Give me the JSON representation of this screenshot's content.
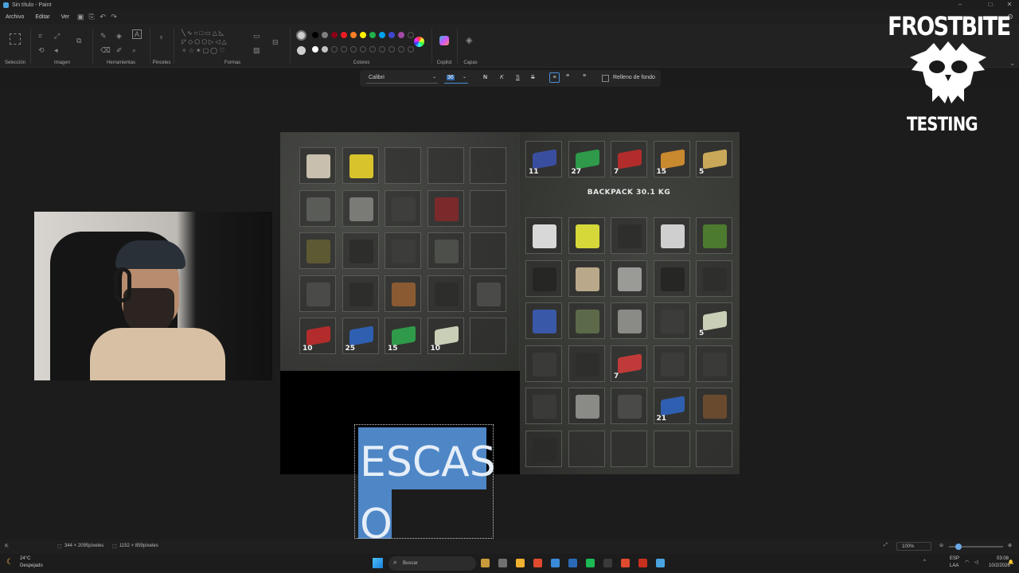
{
  "titlebar": {
    "title": "Sin título - Paint"
  },
  "menu": {
    "file": "Archivo",
    "edit": "Editar",
    "view": "Ver"
  },
  "ribbon": {
    "groups": [
      "Selección",
      "Imagen",
      "Herramientas",
      "Pinceles",
      "Formas",
      "Colores",
      "Copilot",
      "Capas"
    ]
  },
  "textbar": {
    "font": "Calibri",
    "size": "36",
    "bold": "N",
    "italic": "K",
    "underline": "S",
    "strike": "S",
    "fill_label": "Relleno de fondo"
  },
  "colors": {
    "palette_row1": [
      "#000000",
      "#7f7f7f",
      "#880015",
      "#ed1c24",
      "#ff7f27",
      "#fff200",
      "#22b14c",
      "#00a2e8",
      "#3f48cc",
      "#a349a4"
    ],
    "palette_row2": [
      "#ffffff",
      "#c3c3c3"
    ],
    "primary": "#d0d0d0",
    "secondary": "#d0d0d0"
  },
  "inventory": {
    "backpack_label": "BACKPACK 30.1 KG",
    "top_slots": [
      {
        "qty": "11",
        "color": "#3a4ea0",
        "icon": "ammo-box-icon"
      },
      {
        "qty": "27",
        "color": "#2e9a4a",
        "icon": "ammo-box-icon"
      },
      {
        "qty": "7",
        "color": "#b22c2c",
        "icon": "ammo-box-icon"
      },
      {
        "qty": "15",
        "color": "#c9892e",
        "icon": "ammo-box-icon"
      },
      {
        "qty": "5",
        "color": "#c9a85a",
        "icon": "ammo-box-icon"
      }
    ],
    "left_grid": [
      [
        {
          "qty": "",
          "color": "#c8bfae",
          "icon": "bag-icon"
        },
        {
          "qty": "",
          "color": "#d8c32c",
          "icon": "canned-food-icon"
        },
        {
          "qty": "",
          "color": "",
          "icon": ""
        },
        {
          "qty": "",
          "color": "",
          "icon": ""
        },
        {
          "qty": "",
          "color": "",
          "icon": ""
        }
      ],
      [
        {
          "qty": "",
          "color": "#5a5c58",
          "icon": "tool-icon"
        },
        {
          "qty": "",
          "color": "#7a7a76",
          "icon": "knife-icon"
        },
        {
          "qty": "",
          "color": "#3e3f3c",
          "icon": "rifle-part-icon"
        },
        {
          "qty": "",
          "color": "#7a2a2a",
          "icon": "flashlight-icon"
        },
        {
          "qty": "",
          "color": "",
          "icon": ""
        }
      ],
      [
        {
          "qty": "",
          "color": "#5d5a33",
          "icon": "camo-jacket-icon"
        },
        {
          "qty": "",
          "color": "#2d2e2c",
          "icon": "cap-icon"
        },
        {
          "qty": "",
          "color": "#3c3d3a",
          "icon": "helmet-icon"
        },
        {
          "qty": "",
          "color": "#4d4f4a",
          "icon": "vest-icon"
        },
        {
          "qty": "",
          "color": "",
          "icon": ""
        }
      ],
      [
        {
          "qty": "",
          "color": "#4a4b48",
          "icon": "revolver-icon"
        },
        {
          "qty": "",
          "color": "#2d2e2c",
          "icon": "assault-rifle-icon"
        },
        {
          "qty": "",
          "color": "#8a5a32",
          "icon": "ak-rifle-icon"
        },
        {
          "qty": "",
          "color": "#2d2e2c",
          "icon": "rifle-icon"
        },
        {
          "qty": "",
          "color": "#4a4b48",
          "icon": "smg-icon"
        }
      ],
      [
        {
          "qty": "10",
          "color": "#b22c2c",
          "icon": "ammo-box-icon"
        },
        {
          "qty": "25",
          "color": "#2f5fb0",
          "icon": "ammo-box-icon"
        },
        {
          "qty": "15",
          "color": "#2e9a4a",
          "icon": "ammo-box-icon"
        },
        {
          "qty": "10",
          "color": "#c9cfb6",
          "icon": "ammo-box-icon"
        },
        {
          "qty": "",
          "color": "",
          "icon": ""
        }
      ]
    ],
    "right_grid": [
      [
        {
          "qty": "",
          "color": "#d8d8d8",
          "icon": "milk-carton-icon"
        },
        {
          "qty": "",
          "color": "#d6d83a",
          "icon": "juice-box-icon"
        },
        {
          "qty": "",
          "color": "#2e2f2d",
          "icon": "scope-icon"
        },
        {
          "qty": "",
          "color": "#cfcfcf",
          "icon": "compass-icon"
        },
        {
          "qty": "",
          "color": "#4c7a2e",
          "icon": "bottle-icon"
        }
      ],
      [
        {
          "qty": "",
          "color": "#262725",
          "icon": "holster-icon"
        },
        {
          "qty": "",
          "color": "#b9a88a",
          "icon": "pill-bottle-icon"
        },
        {
          "qty": "",
          "color": "#9a9a96",
          "icon": "lighter-icon"
        },
        {
          "qty": "",
          "color": "#262725",
          "icon": "tire-icon"
        },
        {
          "qty": "",
          "color": "#2e2f2d",
          "icon": "rifle-part-icon"
        }
      ],
      [
        {
          "qty": "",
          "color": "#3a58a8",
          "icon": "duct-tape-icon"
        },
        {
          "qty": "",
          "color": "#5c6a4a",
          "icon": "canteen-icon"
        },
        {
          "qty": "",
          "color": "#8a8a86",
          "icon": "knife-icon"
        },
        {
          "qty": "",
          "color": "#3c3d3a",
          "icon": "sniper-rifle-icon"
        },
        {
          "qty": "5",
          "color": "#c9cfb6",
          "icon": "ammo-box-icon"
        }
      ],
      [
        {
          "qty": "",
          "color": "#3a3b38",
          "icon": "tool-icon"
        },
        {
          "qty": "",
          "color": "#2e2f2d",
          "icon": "grip-icon"
        },
        {
          "qty": "7",
          "color": "#c03a3a",
          "icon": "ammo-box-icon"
        },
        {
          "qty": "",
          "color": "#3c3d3a",
          "icon": "shotgun-icon"
        },
        {
          "qty": "",
          "color": "#3a3b38",
          "icon": "rifle-part-icon"
        }
      ],
      [
        {
          "qty": "",
          "color": "#3a3b38",
          "icon": "gas-mask-icon"
        },
        {
          "qty": "",
          "color": "#8a8a86",
          "icon": "knife-icon"
        },
        {
          "qty": "",
          "color": "#4a4b48",
          "icon": "rifle-icon"
        },
        {
          "qty": "21",
          "color": "#2f5fb0",
          "icon": "ammo-box-icon"
        },
        {
          "qty": "",
          "color": "#6a4a2e",
          "icon": "axe-icon"
        }
      ],
      [
        {
          "qty": "",
          "color": "#2b2c2a",
          "icon": "jacket-icon"
        },
        {
          "qty": "",
          "color": "",
          "icon": ""
        },
        {
          "qty": "",
          "color": "",
          "icon": ""
        },
        {
          "qty": "",
          "color": "",
          "icon": ""
        },
        {
          "qty": "",
          "color": "",
          "icon": ""
        }
      ]
    ]
  },
  "canvas_text": {
    "line1": "ESCAS",
    "line2": "O"
  },
  "logo": {
    "title": "FROSTBITE",
    "subtitle": "TESTING"
  },
  "statusbar": {
    "selection_size": "344 × 2095píxeles",
    "canvas_size": "1152 × 859píxeles",
    "zoom": "100%"
  },
  "taskbar": {
    "weather_temp": "24°C",
    "weather_desc": "Despejado",
    "search_placeholder": "Buscar",
    "lang1": "ESP",
    "lang2": "LAA",
    "time": "03:08",
    "date": "10/2/2026"
  }
}
